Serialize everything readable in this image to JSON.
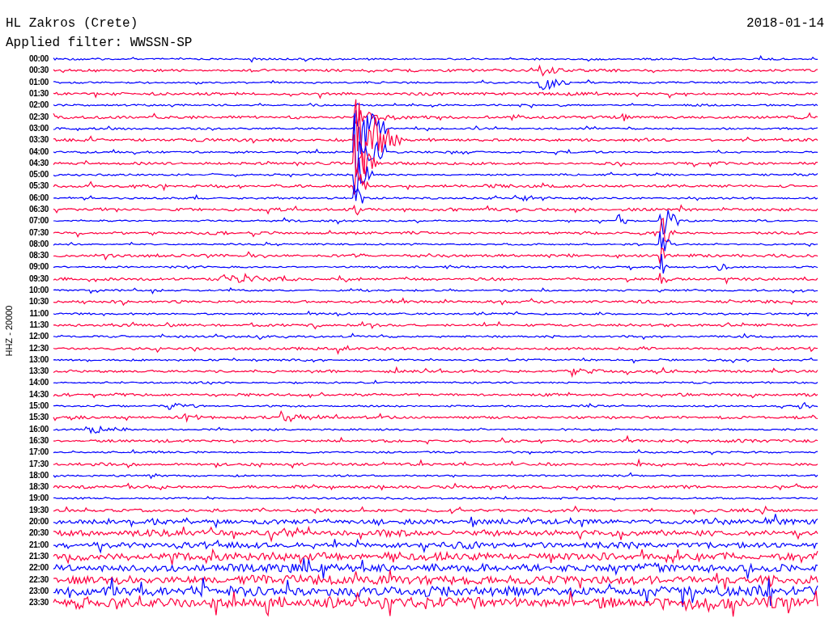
{
  "station": "HL Zakros (Crete)",
  "date": "2018-01-14",
  "filter": "Applied filter: WWSSN-SP",
  "channel_label": "HHZ - 20000",
  "rows": [
    {
      "time": "00:00",
      "color": "#0000ff"
    },
    {
      "time": "00:30",
      "color": "#ff0040"
    },
    {
      "time": "01:00",
      "color": "#0000ff"
    },
    {
      "time": "01:30",
      "color": "#ff0040"
    },
    {
      "time": "02:00",
      "color": "#0000ff"
    },
    {
      "time": "02:30",
      "color": "#ff0040"
    },
    {
      "time": "03:00",
      "color": "#0000ff"
    },
    {
      "time": "03:30",
      "color": "#ff0040"
    },
    {
      "time": "04:00",
      "color": "#0000ff"
    },
    {
      "time": "04:30",
      "color": "#ff0040"
    },
    {
      "time": "05:00",
      "color": "#0000ff"
    },
    {
      "time": "05:30",
      "color": "#ff0040"
    },
    {
      "time": "06:00",
      "color": "#0000ff"
    },
    {
      "time": "06:30",
      "color": "#ff0040"
    },
    {
      "time": "07:00",
      "color": "#0000ff"
    },
    {
      "time": "07:30",
      "color": "#ff0040"
    },
    {
      "time": "08:00",
      "color": "#0000ff"
    },
    {
      "time": "08:30",
      "color": "#ff0040"
    },
    {
      "time": "09:00",
      "color": "#0000ff"
    },
    {
      "time": "09:30",
      "color": "#ff0040"
    },
    {
      "time": "10:00",
      "color": "#0000ff"
    },
    {
      "time": "10:30",
      "color": "#ff0040"
    },
    {
      "time": "11:00",
      "color": "#0000ff"
    },
    {
      "time": "11:30",
      "color": "#ff0040"
    },
    {
      "time": "12:00",
      "color": "#0000ff"
    },
    {
      "time": "12:30",
      "color": "#ff0040"
    },
    {
      "time": "13:00",
      "color": "#0000ff"
    },
    {
      "time": "13:30",
      "color": "#ff0040"
    },
    {
      "time": "14:00",
      "color": "#0000ff"
    },
    {
      "time": "14:30",
      "color": "#ff0040"
    },
    {
      "time": "15:00",
      "color": "#0000ff"
    },
    {
      "time": "15:30",
      "color": "#ff0040"
    },
    {
      "time": "16:00",
      "color": "#0000ff"
    },
    {
      "time": "16:30",
      "color": "#ff0040"
    },
    {
      "time": "17:00",
      "color": "#0000ff"
    },
    {
      "time": "17:30",
      "color": "#ff0040"
    },
    {
      "time": "18:00",
      "color": "#0000ff"
    },
    {
      "time": "18:30",
      "color": "#ff0040"
    },
    {
      "time": "19:00",
      "color": "#0000ff"
    },
    {
      "time": "19:30",
      "color": "#ff0040"
    },
    {
      "time": "20:00",
      "color": "#0000ff"
    },
    {
      "time": "20:30",
      "color": "#ff0040"
    },
    {
      "time": "21:00",
      "color": "#0000ff"
    },
    {
      "time": "21:30",
      "color": "#ff0040"
    },
    {
      "time": "22:00",
      "color": "#0000ff"
    },
    {
      "time": "22:30",
      "color": "#ff0040"
    },
    {
      "time": "23:00",
      "color": "#0000ff"
    },
    {
      "time": "23:30",
      "color": "#ff0040"
    }
  ]
}
